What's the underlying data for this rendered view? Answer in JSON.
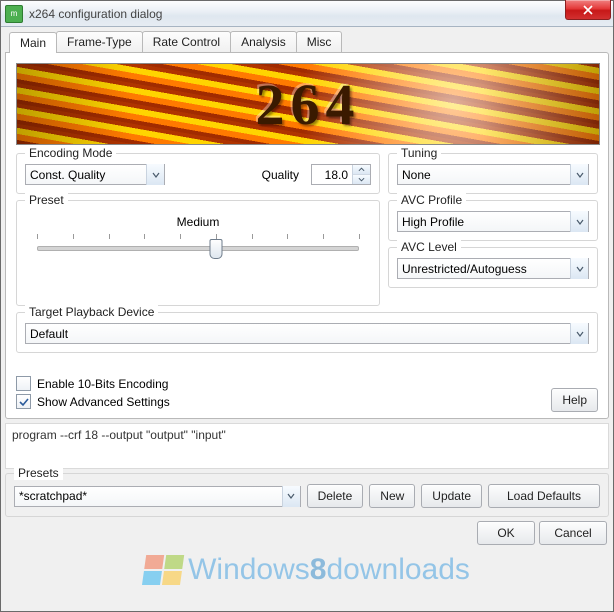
{
  "window": {
    "title": "x264 configuration dialog",
    "close_glyph": "×"
  },
  "tabs": [
    "Main",
    "Frame-Type",
    "Rate Control",
    "Analysis",
    "Misc"
  ],
  "active_tab": 0,
  "banner_text": "264",
  "encoding_mode": {
    "legend": "Encoding Mode",
    "mode_value": "Const. Quality",
    "quality_label": "Quality",
    "quality_value": "18.0"
  },
  "tuning": {
    "legend": "Tuning",
    "value": "None"
  },
  "preset": {
    "legend": "Preset",
    "value_label": "Medium",
    "ticks": 10,
    "position": 5
  },
  "avc_profile": {
    "legend": "AVC Profile",
    "value": "High Profile"
  },
  "avc_level": {
    "legend": "AVC Level",
    "value": "Unrestricted/Autoguess"
  },
  "playback": {
    "legend": "Target Playback Device",
    "value": "Default"
  },
  "checks": {
    "ten_bit_label": "Enable 10-Bits Encoding",
    "ten_bit_checked": false,
    "advanced_label": "Show Advanced Settings",
    "advanced_checked": true
  },
  "help_label": "Help",
  "cmdline": "program --crf 18 --output \"output\" \"input\"",
  "presets": {
    "legend": "Presets",
    "value": "*scratchpad*",
    "delete_label": "Delete",
    "new_label": "New",
    "update_label": "Update",
    "load_defaults_label": "Load Defaults"
  },
  "footer": {
    "ok_label": "OK",
    "cancel_label": "Cancel"
  },
  "watermark": {
    "prefix": "Windows",
    "bold": "8",
    "suffix": "downloads"
  }
}
